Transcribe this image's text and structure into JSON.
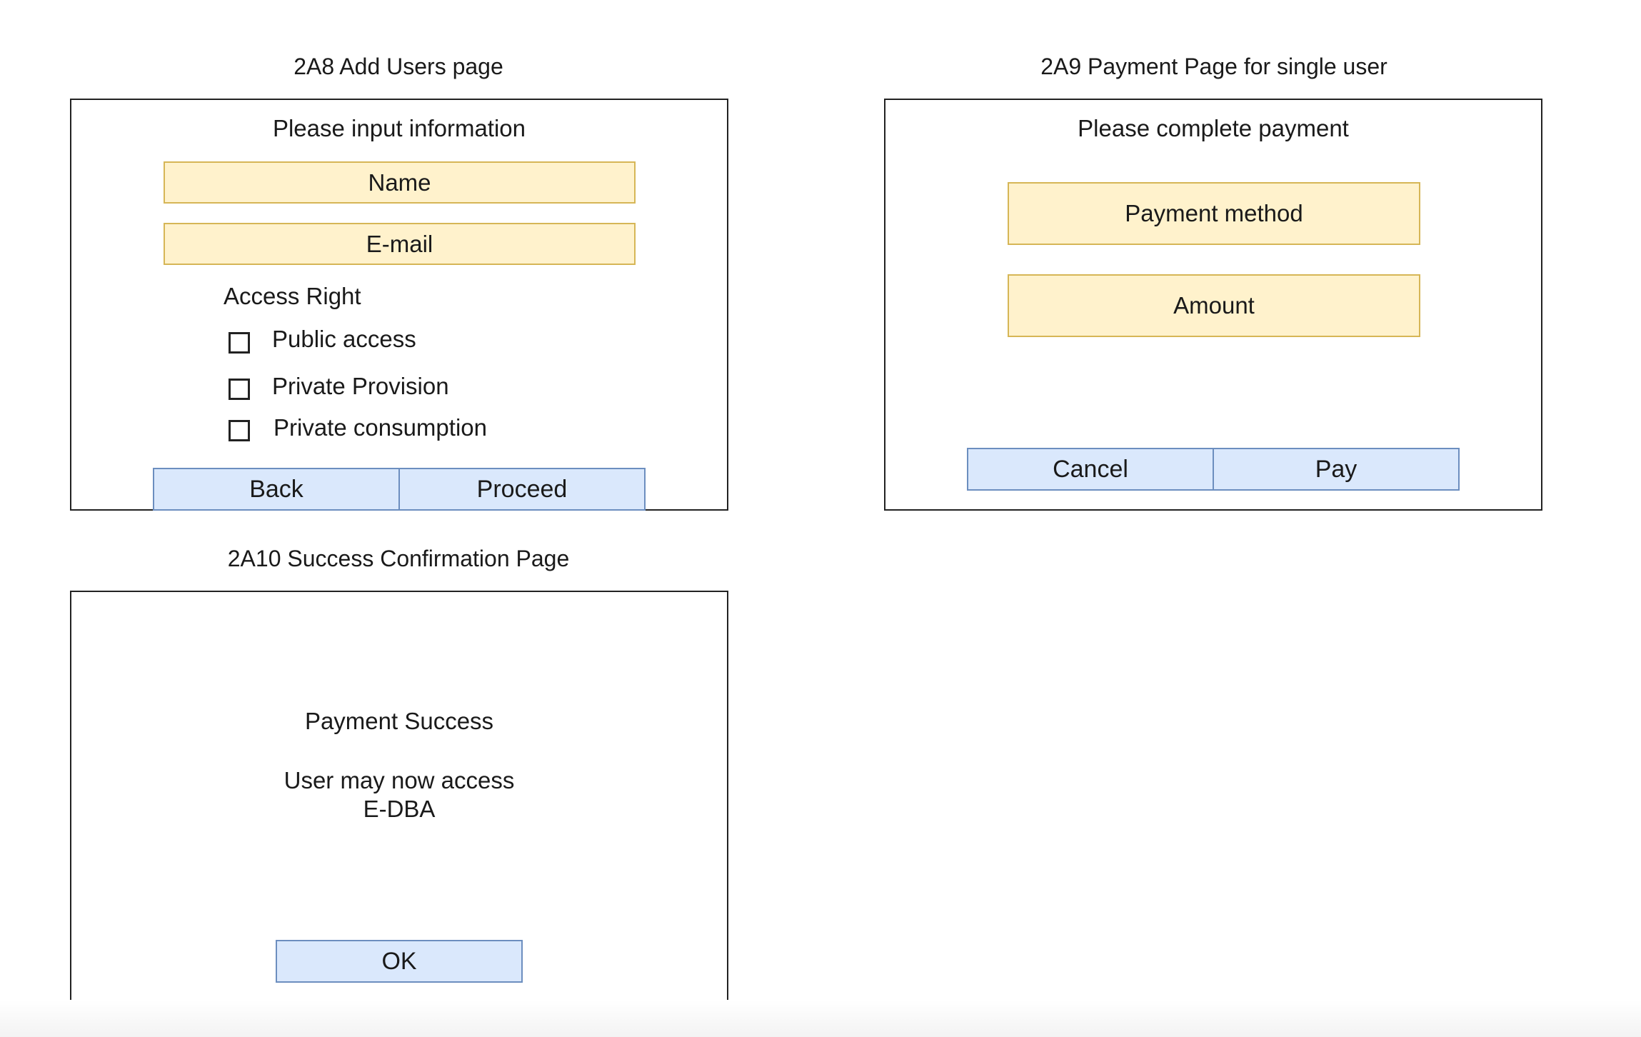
{
  "add_users": {
    "caption": "2A8 Add Users page",
    "heading": "Please input information",
    "name_field": "Name",
    "email_field": "E-mail",
    "access_right_label": "Access Right",
    "options": [
      "Public access",
      "Private Provision",
      "Private consumption"
    ],
    "back_label": "Back",
    "proceed_label": "Proceed"
  },
  "payment": {
    "caption": "2A9 Payment Page for single user",
    "heading": "Please complete payment",
    "method_field": "Payment method",
    "amount_field": "Amount",
    "cancel_label": "Cancel",
    "pay_label": "Pay"
  },
  "success": {
    "caption": "2A10 Success Confirmation Page",
    "title": "Payment Success",
    "message_line1": "User may now access",
    "message_line2": "E-DBA",
    "ok_label": "OK"
  },
  "colors": {
    "field_fill": "#fff2cc",
    "field_border": "#d6b656",
    "button_fill": "#dae8fc",
    "button_border": "#6c8ebf",
    "frame_border": "#222222"
  }
}
